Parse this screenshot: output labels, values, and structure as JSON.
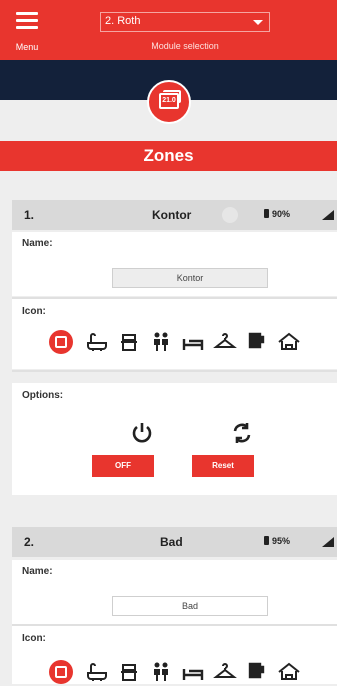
{
  "header": {
    "menu_label": "Menu",
    "module_value": "2. Roth",
    "module_label": "Module selection",
    "badge_text": "21.0"
  },
  "zones_title": "Zones",
  "zones": [
    {
      "number": "1.",
      "name": "Kontor",
      "battery": "90%",
      "name_label": "Name:",
      "name_value": "Kontor",
      "icon_label": "Icon:",
      "options_label": "Options:",
      "off_label": "OFF",
      "reset_label": "Reset"
    },
    {
      "number": "2.",
      "name": "Bad",
      "battery": "95%",
      "name_label": "Name:",
      "name_value": "Bad",
      "icon_label": "Icon:"
    }
  ],
  "icons": [
    "zone-icon",
    "bath-icon",
    "kitchen-icon",
    "people-icon",
    "bed-icon",
    "hanger-icon",
    "cup-icon",
    "home-icon"
  ],
  "colors": {
    "accent": "#e8352e",
    "dark_band": "#13213a",
    "zone_header": "#d9d9d9"
  }
}
